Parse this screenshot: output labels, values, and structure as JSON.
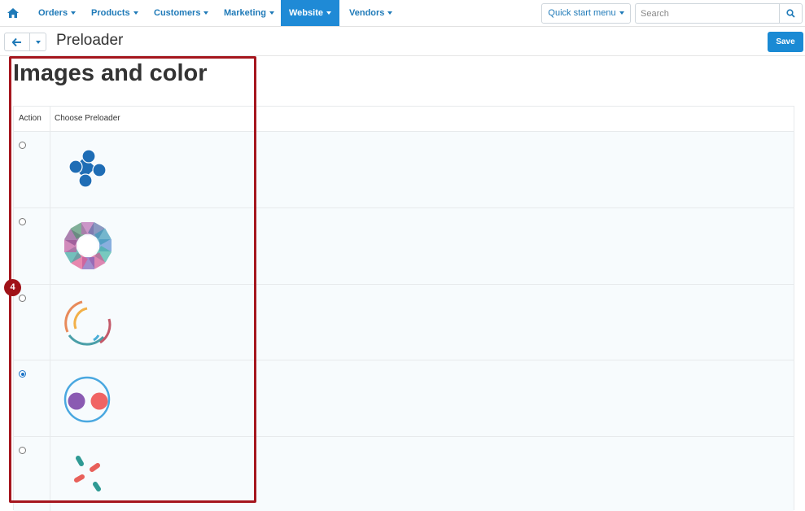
{
  "nav": {
    "items": [
      {
        "label": "Orders"
      },
      {
        "label": "Products"
      },
      {
        "label": "Customers"
      },
      {
        "label": "Marketing"
      },
      {
        "label": "Website"
      },
      {
        "label": "Vendors"
      }
    ],
    "active": "Website",
    "quick_start_label": "Quick start menu",
    "search_placeholder": "Search",
    "accent_color": "#1f8ad6"
  },
  "toolbar": {
    "page_title": "Preloader",
    "save_label": "Save"
  },
  "section": {
    "title": "Images and color",
    "columns": [
      "Action",
      "Choose Preloader"
    ],
    "rows": [
      {
        "preloader": "blue-dots-cross",
        "selected": false
      },
      {
        "preloader": "colorful-squares-ring",
        "selected": false
      },
      {
        "preloader": "arc-spinner",
        "selected": false
      },
      {
        "preloader": "circle-two-dots",
        "selected": true
      },
      {
        "preloader": "dashes-x",
        "selected": false
      }
    ]
  },
  "annotation": {
    "step": "4",
    "color": "#a5161e"
  }
}
